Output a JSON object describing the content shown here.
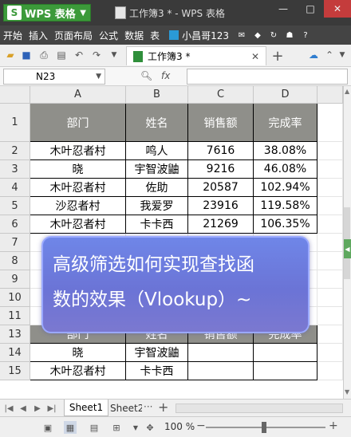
{
  "titlebar": {
    "app_button": "WPS 表格",
    "doc_title": "工作簿3 * - WPS 表格"
  },
  "menu": {
    "items": [
      "开始",
      "插入",
      "页面布局",
      "公式",
      "数据",
      "表"
    ],
    "user": "小昌哥123"
  },
  "toolbar": {
    "doc_tab": "工作簿3 *"
  },
  "formula_bar": {
    "name_box": "N23",
    "fx": "fx",
    "formula": ""
  },
  "grid": {
    "columns": [
      "A",
      "B",
      "C",
      "D"
    ],
    "rows": [
      {
        "n": "1",
        "cells": [
          "部门",
          "姓名",
          "销售额",
          "完成率"
        ]
      },
      {
        "n": "2",
        "cells": [
          "木叶忍者村",
          "鸣人",
          "7616",
          "38.08%"
        ]
      },
      {
        "n": "3",
        "cells": [
          "晓",
          "宇智波鼬",
          "9216",
          "46.08%"
        ]
      },
      {
        "n": "4",
        "cells": [
          "木叶忍者村",
          "佐助",
          "20587",
          "102.94%"
        ]
      },
      {
        "n": "5",
        "cells": [
          "沙忍者村",
          "我爱罗",
          "23916",
          "119.58%"
        ]
      },
      {
        "n": "6",
        "cells": [
          "木叶忍者村",
          "卡卡西",
          "21269",
          "106.35%"
        ]
      },
      {
        "n": "7",
        "cells": [
          "",
          "",
          "",
          ""
        ]
      },
      {
        "n": "8",
        "cells": [
          "",
          "",
          "",
          ""
        ]
      },
      {
        "n": "9",
        "cells": [
          "",
          "",
          "",
          ""
        ]
      },
      {
        "n": "10",
        "cells": [
          "",
          "",
          "",
          ""
        ]
      },
      {
        "n": "11",
        "cells": [
          "",
          "",
          "",
          ""
        ]
      },
      {
        "n": "13",
        "cells": [
          "部门",
          "姓名",
          "销售额",
          "完成率"
        ]
      },
      {
        "n": "14",
        "cells": [
          "晓",
          "宇智波鼬",
          "",
          ""
        ]
      },
      {
        "n": "15",
        "cells": [
          "木叶忍者村",
          "卡卡西",
          "",
          ""
        ]
      }
    ]
  },
  "overlay": {
    "line1": "高级筛选如何实现查找函",
    "line2": "数的效果（Vlookup）~"
  },
  "sheets": {
    "tab1": "Sheet1",
    "tab2": "Sheet2"
  },
  "status": {
    "zoom": "100 %"
  },
  "colors": {
    "header_fill": "#8f8f8a",
    "wps_green": "#3c9a3a",
    "overlay": "#6f7ee0"
  }
}
